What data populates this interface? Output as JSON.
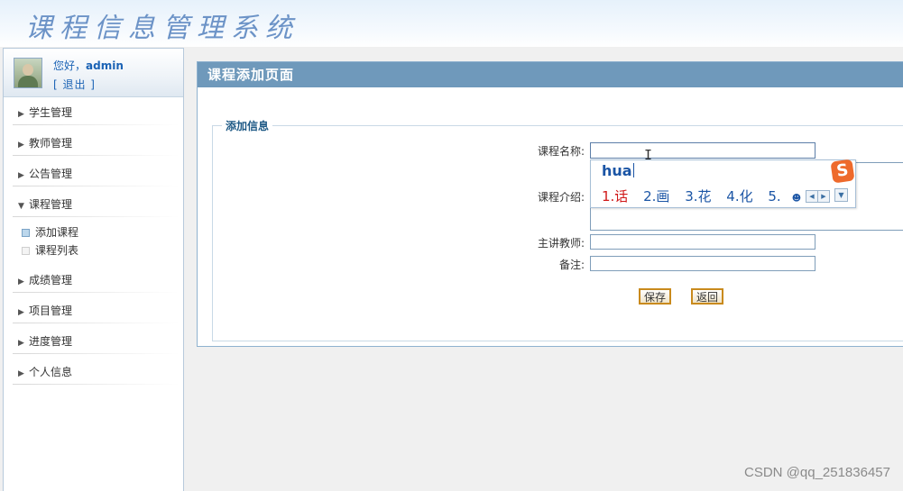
{
  "app": {
    "title": "课程信息管理系统"
  },
  "user": {
    "greeting_prefix": "您好，",
    "name": "admin",
    "logout": "[ 退出 ]"
  },
  "sidebar": {
    "items": [
      {
        "label": "学生管理",
        "expanded": false
      },
      {
        "label": "教师管理",
        "expanded": false
      },
      {
        "label": "公告管理",
        "expanded": false
      },
      {
        "label": "课程管理",
        "expanded": true
      },
      {
        "label": "成绩管理",
        "expanded": false
      },
      {
        "label": "项目管理",
        "expanded": false
      },
      {
        "label": "进度管理",
        "expanded": false
      },
      {
        "label": "个人信息",
        "expanded": false
      }
    ],
    "course_sub": [
      {
        "label": "添加课程",
        "active": true
      },
      {
        "label": "课程列表",
        "active": false
      }
    ]
  },
  "page": {
    "title": "课程添加页面",
    "legend": "添加信息",
    "fields": {
      "course_name_label": "课程名称:",
      "course_intro_label": "课程介绍:",
      "teacher_label": "主讲教师:",
      "remark_label": "备注:"
    },
    "buttons": {
      "save": "保存",
      "back": "返回"
    }
  },
  "ime": {
    "composition": "hua",
    "candidates": [
      "1.话",
      "2.画",
      "3.花",
      "4.化",
      "5."
    ],
    "logo": "S"
  },
  "watermark": "CSDN @qq_251836457"
}
